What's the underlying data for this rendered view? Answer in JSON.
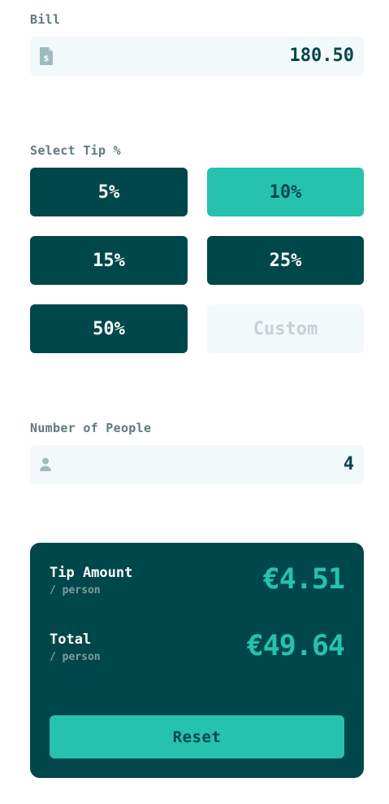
{
  "bill": {
    "label": "Bill",
    "value": "180.50",
    "icon": "dollar-document-icon"
  },
  "tip": {
    "label": "Select Tip %",
    "options": [
      "5%",
      "10%",
      "15%",
      "25%",
      "50%"
    ],
    "selected": "10%",
    "custom_placeholder": "Custom"
  },
  "people": {
    "label": "Number of People",
    "value": "4",
    "icon": "person-icon"
  },
  "results": {
    "tip_amount_label": "Tip Amount",
    "tip_amount_sub": "/ person",
    "tip_amount_value": "€4.51",
    "total_label": "Total",
    "total_sub": "/ person",
    "total_value": "€49.64",
    "reset_label": "Reset"
  },
  "colors": {
    "dark_cyan": "#00474b",
    "strong_cyan": "#26c2ae",
    "light_field": "#f3f9fa",
    "label_grey": "#5e7a7d"
  }
}
